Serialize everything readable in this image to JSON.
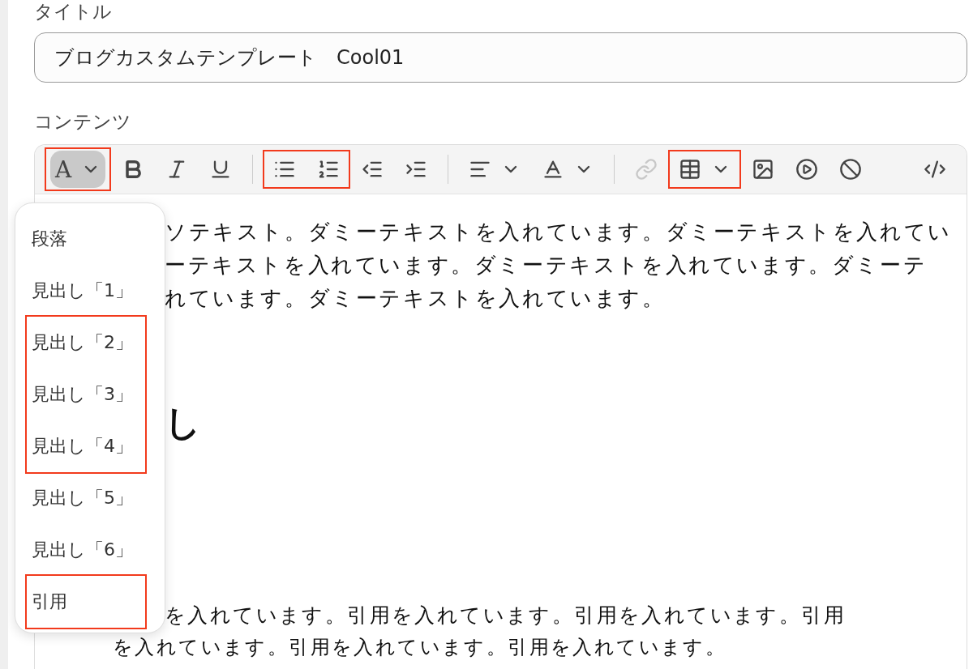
{
  "title_field": {
    "label": "タイトル",
    "value": "ブログカスタムテンプレート　Cool01"
  },
  "content_label": "コンテンツ",
  "toolbar": {
    "groups": [
      {
        "buttons": [
          {
            "kind": "block-format",
            "label": "A",
            "caret": true,
            "active": true,
            "disabled": false,
            "highlighted": true
          },
          {
            "kind": "bold",
            "caret": false,
            "active": false,
            "disabled": false,
            "highlighted": false
          },
          {
            "kind": "italic",
            "caret": false,
            "active": false,
            "disabled": false,
            "highlighted": false
          },
          {
            "kind": "underline",
            "caret": false,
            "active": false,
            "disabled": false,
            "highlighted": false
          }
        ]
      },
      {
        "buttons": [
          {
            "kind": "bullet-list",
            "caret": false,
            "active": false,
            "disabled": false,
            "highlighted": true
          },
          {
            "kind": "numbered-list",
            "caret": false,
            "active": false,
            "disabled": false,
            "highlighted": true
          },
          {
            "kind": "outdent",
            "caret": false,
            "active": false,
            "disabled": false,
            "highlighted": false
          },
          {
            "kind": "indent",
            "caret": false,
            "active": false,
            "disabled": false,
            "highlighted": false
          }
        ]
      },
      {
        "buttons": [
          {
            "kind": "align",
            "caret": true,
            "active": false,
            "disabled": false,
            "highlighted": false
          },
          {
            "kind": "text-color",
            "caret": true,
            "active": false,
            "disabled": false,
            "highlighted": false
          }
        ]
      },
      {
        "buttons": [
          {
            "kind": "link",
            "caret": false,
            "active": false,
            "disabled": true,
            "highlighted": false
          },
          {
            "kind": "table",
            "caret": true,
            "active": false,
            "disabled": false,
            "highlighted": true
          },
          {
            "kind": "image",
            "caret": false,
            "active": false,
            "disabled": false,
            "highlighted": false
          },
          {
            "kind": "video",
            "caret": false,
            "active": false,
            "disabled": false,
            "highlighted": false
          },
          {
            "kind": "clear",
            "caret": false,
            "active": false,
            "disabled": false,
            "highlighted": false
          }
        ]
      }
    ],
    "end": [
      {
        "kind": "code",
        "caret": false,
        "active": false,
        "disabled": false,
        "highlighted": false
      }
    ]
  },
  "format_menu": [
    {
      "label": "段落",
      "highlighted": false
    },
    {
      "label": "見出し「1」",
      "highlighted": false
    },
    {
      "label": "見出し「2」",
      "highlighted": true
    },
    {
      "label": "見出し「3」",
      "highlighted": true
    },
    {
      "label": "見出し「4」",
      "highlighted": true
    },
    {
      "label": "見出し「5」",
      "highlighted": false
    },
    {
      "label": "見出し「6」",
      "highlighted": false
    },
    {
      "label": "引用",
      "highlighted": true
    }
  ],
  "content": [
    {
      "kind": "paragraph",
      "text": "ソテキスト。ダミーテキストを入れています。ダミーテキストを入れてい"
    },
    {
      "kind": "paragraph",
      "text": "ーテキストを入れています。ダミーテキストを入れています。ダミーテ"
    },
    {
      "kind": "paragraph",
      "text": "れています。ダミーテキストを入れています。"
    },
    {
      "kind": "heading-1",
      "text": "し"
    },
    {
      "kind": "quote",
      "text": "を入れています。引用を入れています。引用を入れています。引用"
    },
    {
      "kind": "quote-continued",
      "text": "を入れています。引用を入れています。引用を入れています。"
    }
  ]
}
